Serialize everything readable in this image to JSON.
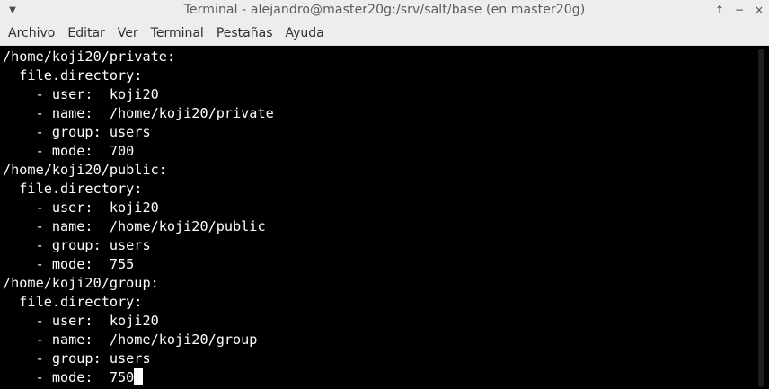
{
  "window": {
    "title": "Terminal - alejandro@master20g:/srv/salt/base (en master20g)",
    "menu_icon": "chevron-down-icon",
    "controls": {
      "minimize": "↑",
      "maximize": "−",
      "close": "×"
    }
  },
  "menubar": {
    "items": [
      "Archivo",
      "Editar",
      "Ver",
      "Terminal",
      "Pestañas",
      "Ayuda"
    ]
  },
  "terminal": {
    "lines": [
      "/home/koji20/private:",
      "  file.directory:",
      "    - user:  koji20",
      "    - name:  /home/koji20/private",
      "    - group: users",
      "    - mode:  700",
      "/home/koji20/public:",
      "  file.directory:",
      "    - user:  koji20",
      "    - name:  /home/koji20/public",
      "    - group: users",
      "    - mode:  755",
      "/home/koji20/group:",
      "  file.directory:",
      "    - user:  koji20",
      "    - name:  /home/koji20/group",
      "    - group: users",
      "    - mode:  750"
    ]
  },
  "colors": {
    "terminal_bg": "#000000",
    "terminal_fg": "#ffffff",
    "chrome_bg": "#ededed"
  }
}
